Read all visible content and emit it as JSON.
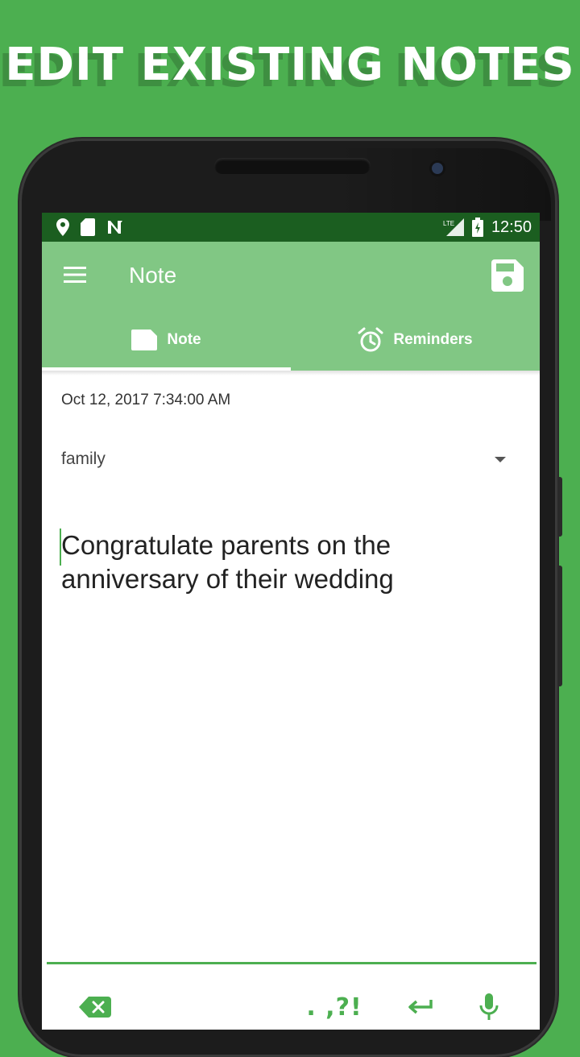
{
  "promo": {
    "headline": "EDIT EXISTING NOTES"
  },
  "status_bar": {
    "time": "12:50",
    "icons_left": [
      "location-icon",
      "sd-card-icon",
      "n-notification-icon"
    ],
    "icons_right": [
      "lte-signal-icon",
      "battery-icon"
    ]
  },
  "app_bar": {
    "title": "Note",
    "menu_icon": "hamburger-menu-icon",
    "save_icon": "save-floppy-icon"
  },
  "tabs": [
    {
      "label": "Note",
      "icon": "note-icon",
      "selected": true
    },
    {
      "label": "Reminders",
      "icon": "alarm-clock-icon",
      "selected": false
    }
  ],
  "note": {
    "date": "Oct 12, 2017 7:34:00 AM",
    "category": "family",
    "body": "Congratulate parents on the anniversary of their wedding"
  },
  "keyboard": {
    "punctuation_label": ". ,?!",
    "keys": [
      "backspace-icon",
      "punctuation-key",
      "enter-icon",
      "microphone-icon"
    ]
  },
  "colors": {
    "background": "#4caf50",
    "status_bar": "#1b5e20",
    "app_bar": "#81c784",
    "accent": "#4caf50"
  }
}
